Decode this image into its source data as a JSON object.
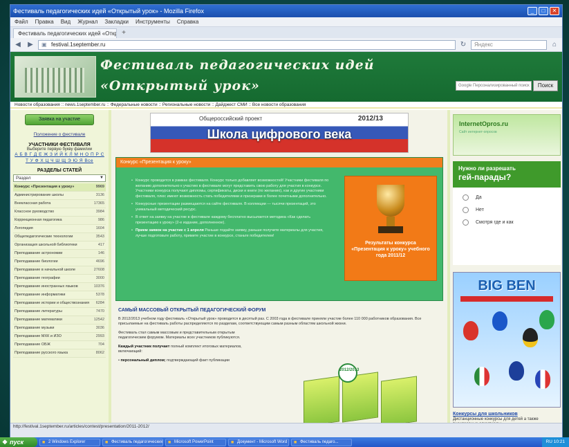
{
  "window": {
    "title": "Фестиваль педагогических идей «Открытый урок» - Mozilla Firefox"
  },
  "menu": [
    "Файл",
    "Правка",
    "Вид",
    "Журнал",
    "Закладки",
    "Инструменты",
    "Справка"
  ],
  "tab": {
    "label": "Фестиваль педагогических идей «Открыт...",
    "new_tab": "+"
  },
  "nav": {
    "url": "festival.1september.ru",
    "search_placeholder": "Яндекс"
  },
  "site": {
    "title_line1": "Фестиваль педагогических идей",
    "title_line2": "«Открытый урок»",
    "search_placeholder": "Google Персонализированный поиск",
    "search_button": "Поиск",
    "newsbar": "Новости образования :: news.1september.ru :: Федеральные новости :: Региональные новости :: Дайджест СМИ :: Все новости образования"
  },
  "left": {
    "apply_button": "Заявка на участие",
    "regulations_link": "Положение о фестивале",
    "participants_heading": "УЧАСТНИКИ ФЕСТИВАЛЯ",
    "alphabet_hint": "Выберите первую букву фамилии",
    "alphabet": "А Б В Г Д Е Ж З И Й К Л М Н О П Р С Т У Ф Х Ц Ч Ш Щ Э Ю Я Все",
    "sections_heading": "РАЗДЕЛЫ СТАТЕЙ",
    "select_value": "Раздел",
    "categories": [
      {
        "name": "Конкурс «Презентация к уроку»",
        "count": "9969"
      },
      {
        "name": "Администрирование школы",
        "count": "3136"
      },
      {
        "name": "Внеклассная работа",
        "count": "17365"
      },
      {
        "name": "Классное руководство",
        "count": "3984"
      },
      {
        "name": "Коррекционная педагогика",
        "count": "986"
      },
      {
        "name": "Логопедия",
        "count": "1604"
      },
      {
        "name": "Общепедагогические технологии",
        "count": "3543"
      },
      {
        "name": "Организация школьной библиотеки",
        "count": "417"
      },
      {
        "name": "Преподавание астрономии",
        "count": "146"
      },
      {
        "name": "Преподавание биологии",
        "count": "4696"
      },
      {
        "name": "Преподавание в начальной школе",
        "count": "27608"
      },
      {
        "name": "Преподавание географии",
        "count": "3000"
      },
      {
        "name": "Преподавание иностранных языков",
        "count": "10376"
      },
      {
        "name": "Преподавание информатики",
        "count": "5378"
      },
      {
        "name": "Преподавание истории и обществознания",
        "count": "6284"
      },
      {
        "name": "Преподавание литературы",
        "count": "7470"
      },
      {
        "name": "Преподавание математики",
        "count": "12542"
      },
      {
        "name": "Преподавание музыки",
        "count": "3036"
      },
      {
        "name": "Преподавание МХК и ИЗО",
        "count": "2993"
      },
      {
        "name": "Преподавание ОБЖ",
        "count": "704"
      },
      {
        "name": "Преподавание русского языка",
        "count": "8062"
      }
    ]
  },
  "center": {
    "banner_project": "Общероссийский проект",
    "banner_year": "2012/13",
    "banner_title": "Школа цифрового века",
    "contest_title": "Конкурс «Презентация к уроку»",
    "contest_items": [
      "Конкурс проводится в рамках фестиваля. Конкурс только добавляет возможностей! Участники фестиваля по желанию дополнительно к участию в фестивале могут представить свою работу для участия в конкурсе. Участники конкурса получают дипломы, сертификаты, диски и книги (по желанию), как и другие участники фестиваля, плюс имеют возможность стать победителями и призерами в более почетными дополнительно.",
      "Конкурсные презентации размещаются на сайте фестиваля. В коллекции — тысячи презентаций, это уникальный методический ресурс.",
      "В ответ на заявку на участие в фестивале каждому бесплатно высылается методика «Как сделать презентацию к уроку» (2-е издание, дополненное)."
    ],
    "contest_deadline_bold": "Прием заявок на участие с 1 апреля",
    "contest_deadline_text": "Раньше подайте заявку, раньше получите материалы для участия, лучше подготовьте работу, примите участие в конкурсе, станьте победителем!",
    "cup_caption": "Результаты конкурса «Презентация к уроку» учебного года 2011/12",
    "forum_heading": "САМЫЙ МАССОВЫЙ ОТКРЫТЫЙ ПЕДАГОГИЧЕСКИЙ ФОРУМ",
    "forum_p1": "В 2012/2013 учебном году фестиваль «Открытый урок» проводится в десятый раз. С 2003 года в фестивале приняли участие более 110 000 работников образования. Все присылаемые на фестиваль работы распределяются по разделам, соответствующим самым разным областям школьной жизни.",
    "forum_p2": "Фестиваль стал самым массовым и представительным открытым педагогическим форумом. Материалы всех участников публикуются.",
    "forum_p3_bold": "Каждый участник получает",
    "forum_p3": "полный комплект итоговых материалов, включающий:",
    "forum_li_bold": "персональный диплом;",
    "forum_li": "подтверждающий факт публикации",
    "badge_text": "2012/2013"
  },
  "right": {
    "ad_brand": "InternetOpros.ru",
    "ad_tagline": "Сайт интернет-опросов",
    "poll_question_small": "Нужно ли разрешать",
    "poll_question_big": "гей-парады?",
    "poll_options": [
      "Да",
      "Нет",
      "Смотря где и как"
    ],
    "bigben_title": "BIG BEN",
    "schools_link": "Конкурсы для школьников",
    "schools_text": "Дистанционные конкурсы для детей а также внеклассные олимпиады..."
  },
  "status": {
    "text": "http://festival.1september.ru/articles/contest/presentation/2011-2012/"
  },
  "taskbar": {
    "start": "пуск",
    "items": [
      "2 Windows Explorer",
      "Фестиваль педагогических",
      "Microsoft PowerPoint",
      "Документ - Microsoft Word",
      "Фестиваль педаго..."
    ],
    "tray": "RU 10:21"
  }
}
